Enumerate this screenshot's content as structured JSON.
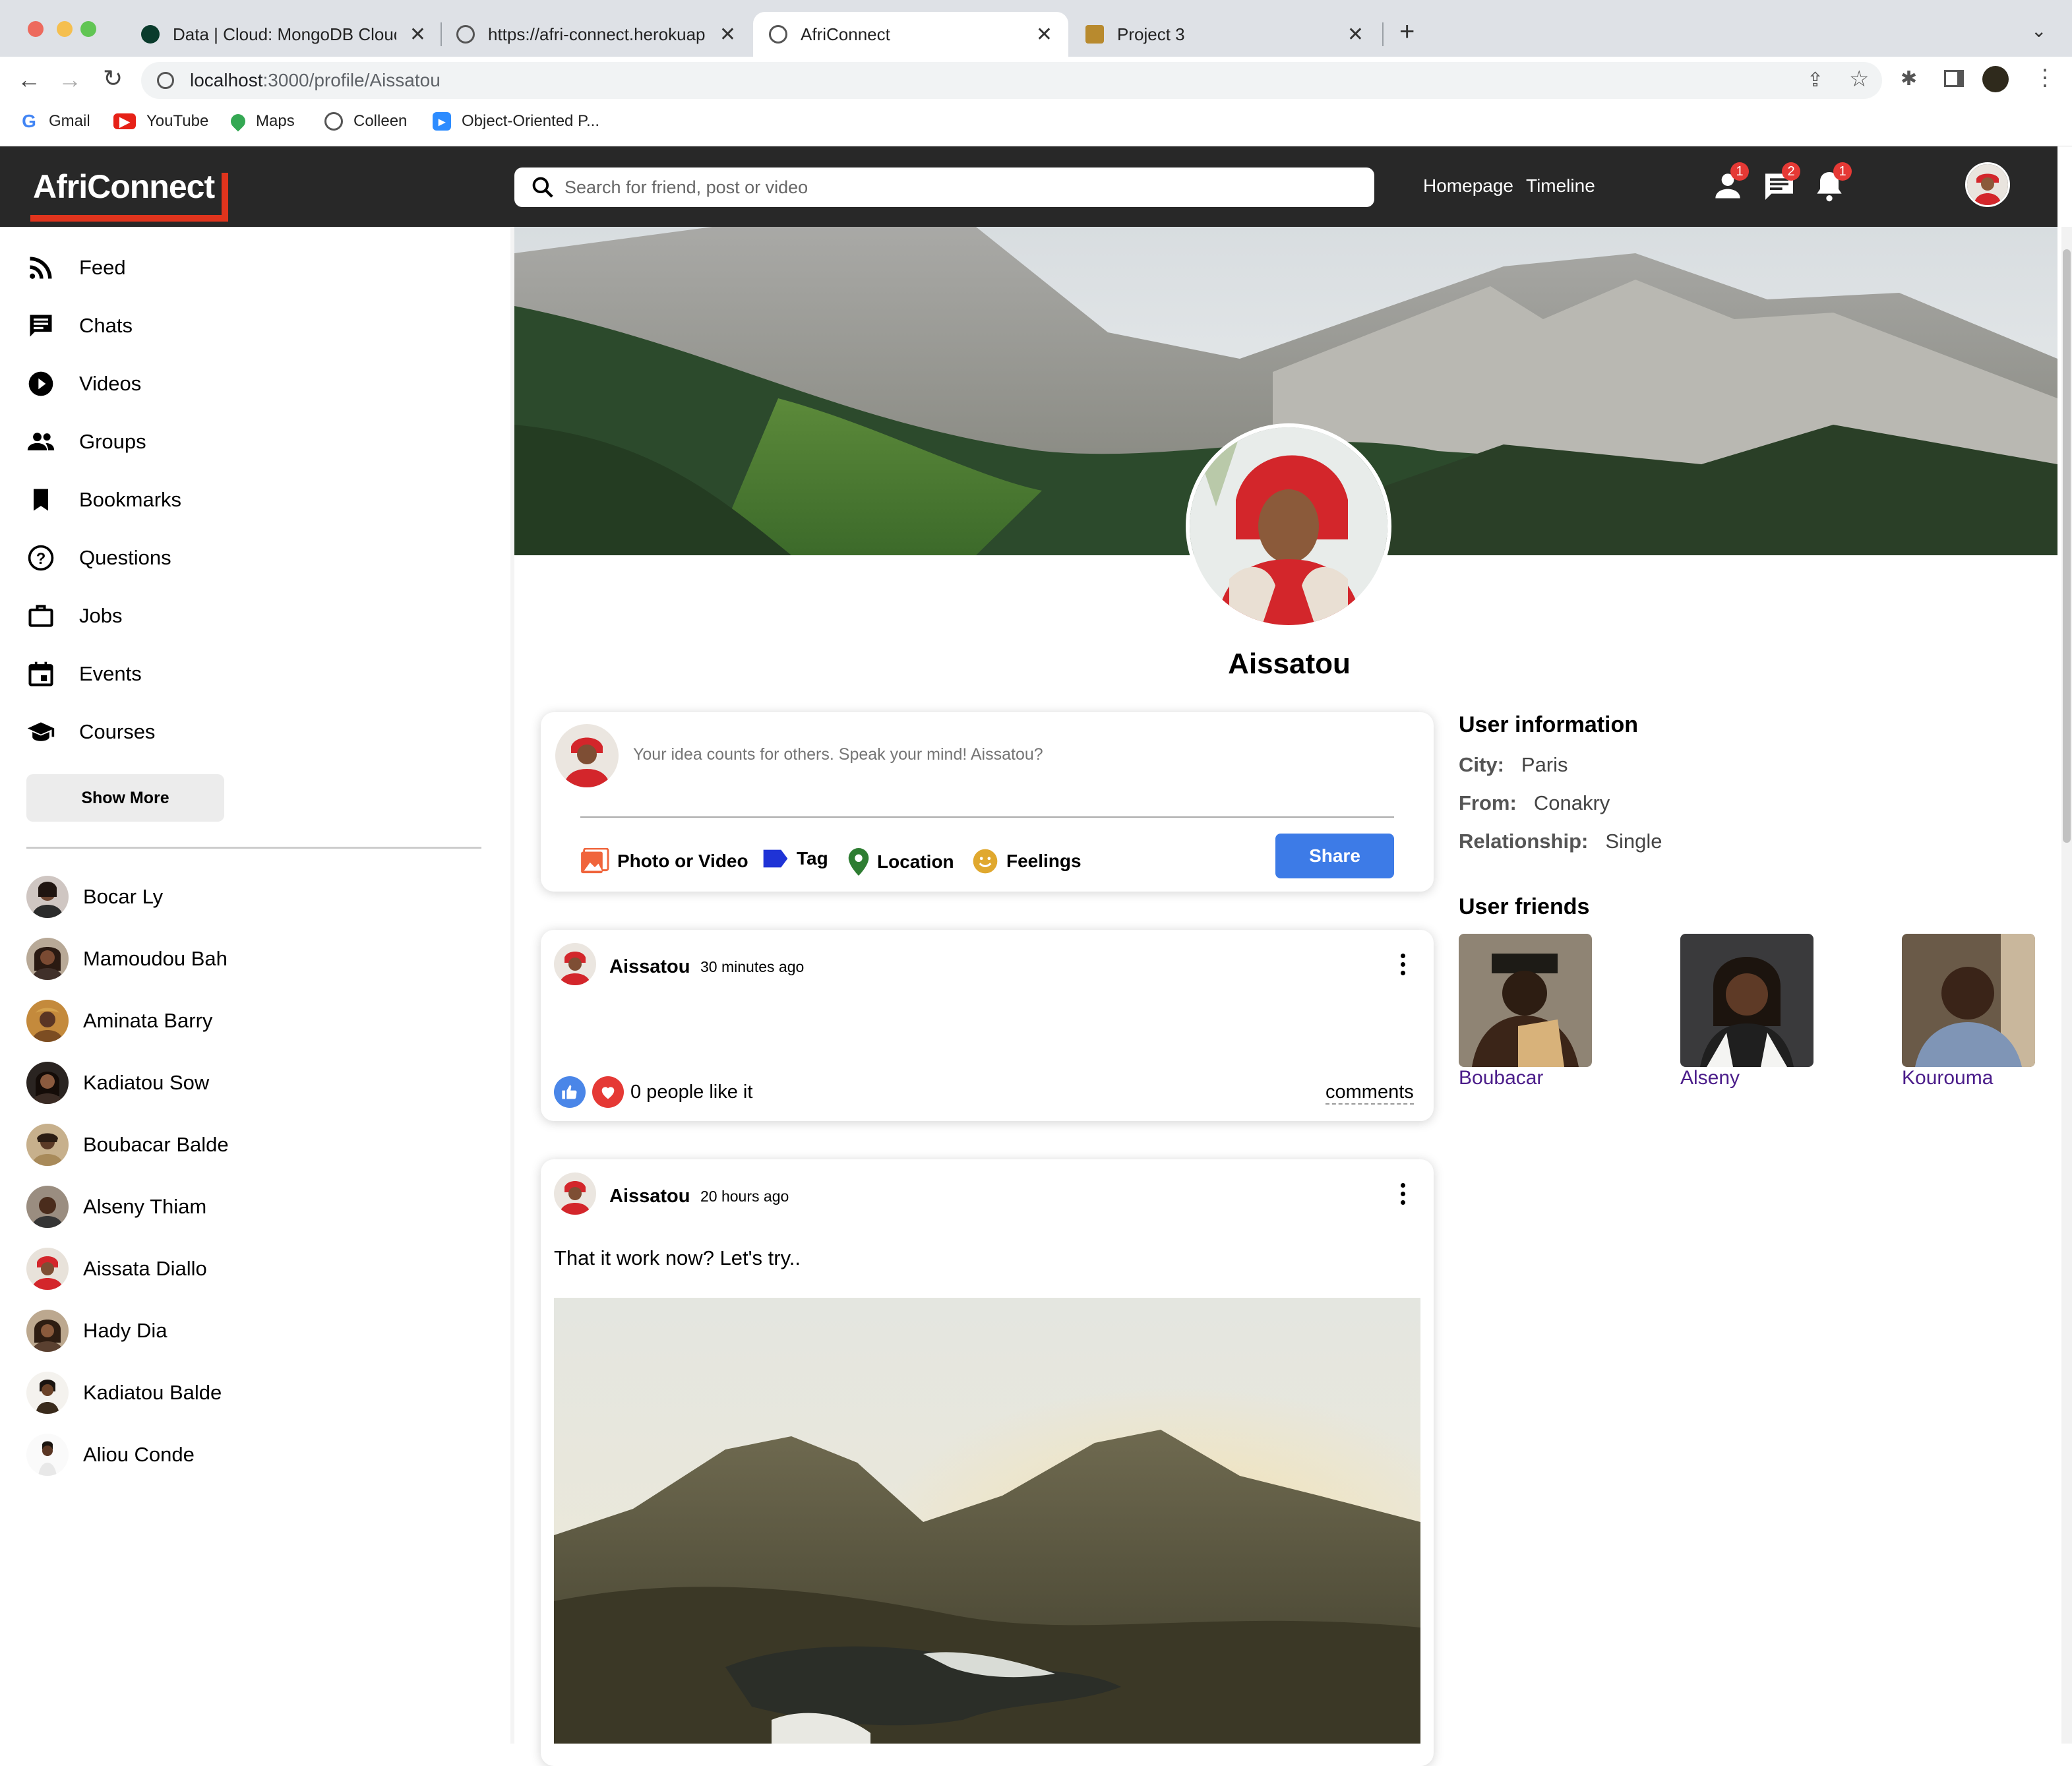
{
  "browser": {
    "tabs": [
      {
        "label": "Data | Cloud: MongoDB Cloud"
      },
      {
        "label": "https://afri-connect.herokuapp"
      },
      {
        "label": "AfriConnect"
      },
      {
        "label": "Project 3"
      }
    ],
    "url_host": "localhost",
    "url_path": ":3000/profile/Aissatou",
    "bookmarks": [
      "Gmail",
      "YouTube",
      "Maps",
      "Colleen",
      "Object-Oriented P..."
    ]
  },
  "app": {
    "logo": "AfriConnect",
    "search_placeholder": "Search for friend, post or video",
    "links": [
      "Homepage",
      "Timeline"
    ],
    "badges": {
      "friends": "1",
      "messages": "2",
      "notifications": "1"
    }
  },
  "sidebar": {
    "items": [
      "Feed",
      "Chats",
      "Videos",
      "Groups",
      "Bookmarks",
      "Questions",
      "Jobs",
      "Events",
      "Courses"
    ],
    "show_more": "Show More",
    "friends": [
      "Bocar Ly",
      "Mamoudou Bah",
      "Aminata Barry",
      "Kadiatou Sow",
      "Boubacar Balde",
      "Alseny Thiam",
      "Aissata Diallo",
      "Hady Dia",
      "Kadiatou Balde",
      "Aliou Conde"
    ]
  },
  "profile": {
    "name": "Aissatou",
    "share_placeholder": "Your idea counts for others. Speak your mind! Aissatou?",
    "share_options": [
      "Photo or Video",
      "Tag",
      "Location",
      "Feelings"
    ],
    "share_button": "Share"
  },
  "posts": [
    {
      "author": "Aissatou",
      "time": "30 minutes ago",
      "text": "",
      "likes": "0 people like it",
      "comments": "comments"
    },
    {
      "author": "Aissatou",
      "time": "20 hours ago",
      "text": "That it work now? Let's try.."
    }
  ],
  "user_info": {
    "title": "User information",
    "city_label": "City:",
    "city": "Paris",
    "from_label": "From:",
    "from": "Conakry",
    "rel_label": "Relationship:",
    "rel": "Single",
    "friends_title": "User friends",
    "friends": [
      "Boubacar",
      "Alseny",
      "Kourouma"
    ]
  },
  "colors": {
    "accent": "#3d7be7",
    "topbar": "#282828",
    "logo_red": "#e0341d",
    "badge": "#e53935"
  }
}
